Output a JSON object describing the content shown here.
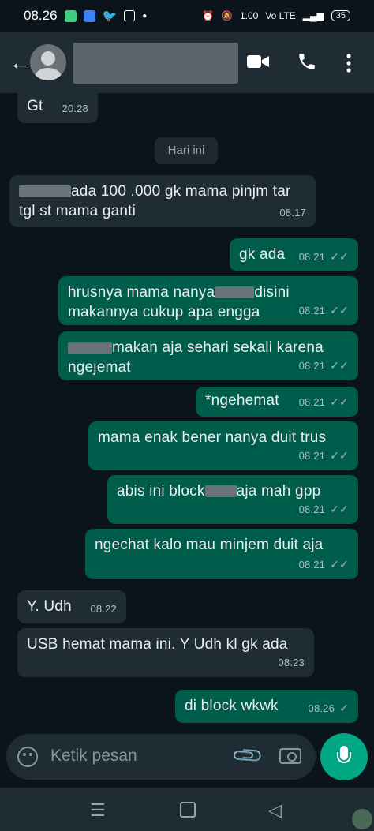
{
  "status_bar": {
    "time": "08.26",
    "net_speed": "1.00\nKB/S",
    "network": "Vo LTE",
    "signal": "4G",
    "battery": "35"
  },
  "header": {
    "back_icon": "arrow-left-icon",
    "video_icon": "video-call-icon",
    "call_icon": "phone-icon",
    "menu_icon": "more-vert-icon"
  },
  "chat": {
    "date_chip": "Hari ini",
    "messages": [
      {
        "dir": "in",
        "text": "Gt",
        "time": "20.28"
      },
      {
        "dir": "in",
        "text1": "ada 100 .000 gk mama pinjm tar",
        "text2": "tgl st mama ganti",
        "time": "08.17"
      },
      {
        "dir": "out",
        "text": "gk ada",
        "time": "08.21"
      },
      {
        "dir": "out",
        "text1a": "hrusnya mama nanya",
        "text1b": "disini",
        "text2": "makannya cukup apa engga",
        "time": "08.21"
      },
      {
        "dir": "out",
        "text1": "makan aja sehari sekali karena",
        "text2": "ngejemat",
        "time": "08.21"
      },
      {
        "dir": "out",
        "text": "*ngehemat",
        "time": "08.21"
      },
      {
        "dir": "out",
        "text": "mama enak bener nanya duit trus",
        "time": "08.21"
      },
      {
        "dir": "out",
        "text1": "abis ini block",
        "text2": "aja mah gpp",
        "time": "08.21"
      },
      {
        "dir": "out",
        "text": "ngechat kalo mau minjem duit aja",
        "time": "08.21"
      },
      {
        "dir": "in",
        "text": "Y. Udh",
        "time": "08.22"
      },
      {
        "dir": "in",
        "text": "USB hemat mama ini. Y Udh kl gk ada",
        "time": "08.23"
      },
      {
        "dir": "out",
        "text": "di block wkwk",
        "time": "08.26"
      }
    ]
  },
  "input": {
    "placeholder": "Ketik pesan"
  },
  "colors": {
    "incoming": "#202c33",
    "outgoing": "#005c4b",
    "accent": "#00a884"
  }
}
